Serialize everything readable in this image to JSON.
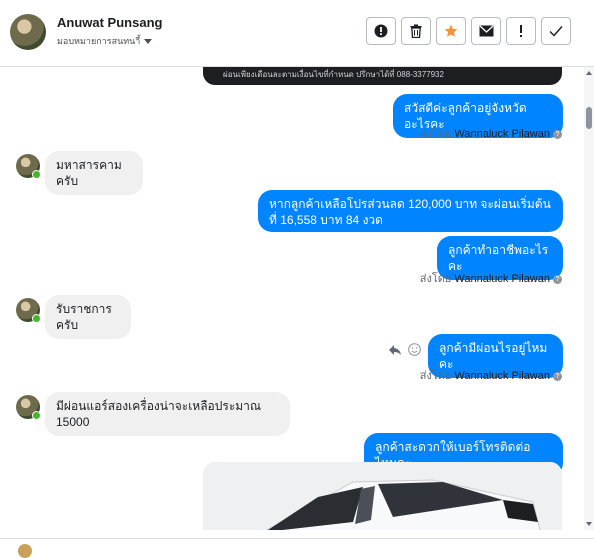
{
  "header": {
    "contact_name": "Anuwat Punsang",
    "assign_label": "มอบหมายการสนทนาี้",
    "tools": [
      "alert-circle-icon",
      "trash-icon",
      "star-icon",
      "mail-icon",
      "exclamation-icon",
      "check-icon"
    ],
    "star_color": "#f7923a"
  },
  "messages": {
    "image_caption_top": "ผ่อนเพียงเดือนละตามเงื่อนไขที่กำหนด ปรึกษาได้ที่ 088-3377932",
    "out_1": "สวัสดีค่ะลูกค้าอยู่จังหวัดอะไรคะ",
    "in_1": "มหาสารคามครับ",
    "out_2": "หากลูกค้าเหลือโปรส่วนลด 120,000  บาท  จะผ่อนเริ่มต้นที่ 16,558 บาท  84 งวด",
    "out_3": "ลูกค้าทำอาชีพอะไรคะ",
    "in_2": "รับราชการครับ",
    "out_4": "ลูกค้ามีผ่อนไรอยู่ไหมคะ",
    "in_3": "มีผ่อนแอร์สองเครื่องน่าจะเหลือประมาณ 15000",
    "out_5": "ลูกค้าสะดวกให้เบอร์โทรติดต่อไหมคะ"
  },
  "sent_by": {
    "prefix": "ส่งโดย",
    "agent": "Wannaluck Pilawan",
    "info": "?"
  },
  "colors": {
    "outgoing_bubble": "#0084ff",
    "incoming_bubble": "#f1f0f0",
    "online_dot": "#42b72a"
  }
}
